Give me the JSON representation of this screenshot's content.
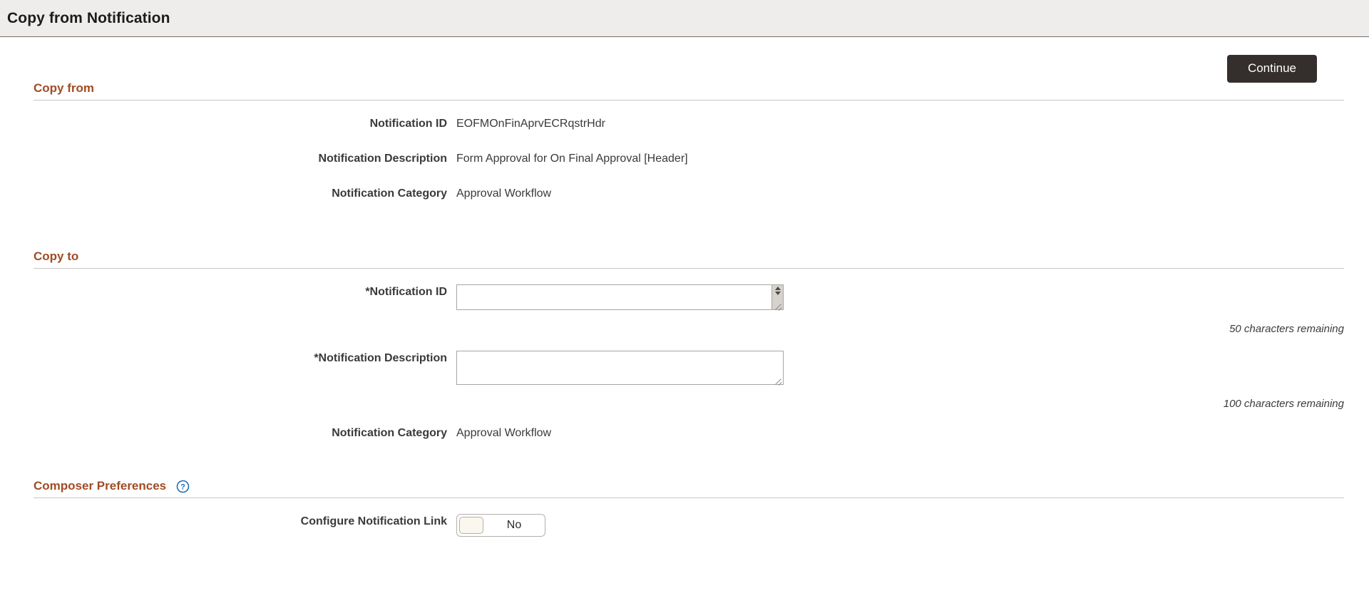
{
  "header": {
    "title": "Copy from Notification"
  },
  "toolbar": {
    "continue_label": "Continue"
  },
  "copy_from": {
    "section_title": "Copy from",
    "fields": [
      {
        "label": "Notification ID",
        "value": "EOFMOnFinAprvECRqstrHdr"
      },
      {
        "label": "Notification Description",
        "value": "Form Approval for On Final Approval [Header]"
      },
      {
        "label": "Notification Category",
        "value": "Approval Workflow"
      }
    ]
  },
  "copy_to": {
    "section_title": "Copy to",
    "notification_id": {
      "label": "*Notification ID",
      "value": "",
      "placeholder": "",
      "chars_remaining": "50 characters remaining"
    },
    "notification_description": {
      "label": "*Notification Description",
      "value": "",
      "placeholder": "",
      "chars_remaining": "100 characters remaining"
    },
    "notification_category": {
      "label": "Notification Category",
      "value": "Approval Workflow"
    }
  },
  "composer_preferences": {
    "section_title": "Composer Preferences",
    "help_icon": "help-circle-icon",
    "configure_notification_link": {
      "label": "Configure Notification Link",
      "state_label": "No"
    }
  },
  "colors": {
    "section_title": "#a14b24",
    "header_band": "#efedeb",
    "button_primary": "#342f2c",
    "help_icon": "#1f6fb5"
  }
}
